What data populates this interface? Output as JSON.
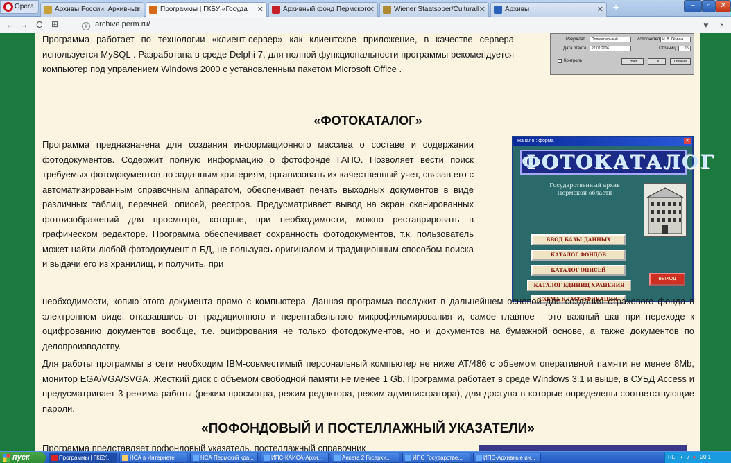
{
  "browser": {
    "menu_label": "Opera",
    "tabs": [
      {
        "label": "Архивы России. Архивные"
      },
      {
        "label": "Программы | ГКБУ «Госуда"
      },
      {
        "label": "Архивный фонд Пермского"
      },
      {
        "label": "Wiener Staatsoper/Culturall"
      },
      {
        "label": "Архивы"
      }
    ],
    "url": "archive.perm.ru/"
  },
  "page": {
    "intro_paragraph": "Программа работает по технологии «клиент-сервер» как клиентское приложение, в качестве сервера используется MySQL . Разработана в среде Delphi 7, для полной функциональности программы рекомендуется компьютер под упралением Windows 2000 с установленным пакетом Microsoft Office .",
    "section1_title": "«ФОТОКАТАЛОГ»",
    "section1_para1": "Программа предназначена для создания информационного массива о составе и содержании фотодокументов. Содержит полную информацию о фотофонде ГАПО. Позволяет вести поиск требуемых фотодокументов по заданным критериям, организовать их качественный учет, связав его с автоматизированным справочным аппаратом, обеспечивает печать выходных документов в виде различных таблиц, перечней, описей, реестров. Предусматривает вывод на экран сканированных фотоизображений для просмотра, которые, при необходимости, можно реставрировать в графическом редакторе. Программа обеспечивает сохранность фотодокументов, т.к. пользователь может найти любой фотодокумент в БД, не пользуясь оригиналом и традиционным способом поиска и выдачи его из хранилищ, и получить, при",
    "section1_para1_cont": "необходимости, копию этого документа прямо с компьютера. Данная программа послужит в дальнейшем основой для создания страхового фонда в электронном виде, отказавшись от традиционного и нерентабельного микрофильмирования и, самое главное - это важный шаг при переходе к оцифрованию документов вообще, т.е. оцифрования не только фотодокументов, но и документов на бумажной основе, а также документов по делопроизводству.",
    "section1_para2": "Для работы программы в сети необходим IBM-совместимый персональный компьютер не ниже AT/486 с объемом оперативной памяти не менее 8Mb, монитор EGA/VGA/SVGA. Жесткий диск с объемом свободной памяти не менее 1 Gb. Программа работает в среде Windows 3.1 и выше, в СУБД Access и предусматривает 3 режима работы (режим просмотра, режим редактора, режим администратора), для доступа в которые определены соответствующие пароли.",
    "section2_title": "«ПОФОНДОВЫЙ И ПОСТЕЛЛАЖНЫЙ УКАЗАТЕЛИ»",
    "section2_partial": "Программа представляет пофондовый указатель, постеллажный справочник"
  },
  "dialog_snippet": {
    "result_label": "Результат",
    "result_value": "Положительный",
    "executor_label": "Исполнитель",
    "executor_value": "И. В. Дёмина",
    "date_label": "Дата ответа",
    "date_value": "22.02.2006",
    "pages_label": "Страниц",
    "pages_value": "15",
    "control_label": "Контроль",
    "btn_report": "Отчет",
    "btn_ok": "Ок",
    "btn_cancel": "Отмена"
  },
  "photocatalog_window": {
    "title": "Начало : форма",
    "brand": "ФОТОКАТАЛОГ",
    "subtitle_line1": "Государственный архив",
    "subtitle_line2": "Пермской области",
    "buttons": [
      {
        "label": "ВВОД БАЗЫ ДАННЫХ"
      },
      {
        "label": "КАТАЛОГ ФОНДОВ"
      },
      {
        "label": "КАТАЛОГ ОПИСЕЙ"
      },
      {
        "label": "КАТАЛОГ ЕДИНИЦ ХРАНЕНИЯ"
      },
      {
        "label": "СХЕМА КЛАССИФИКАЦИИ"
      }
    ],
    "exit_label": "ВЫХОД"
  },
  "taskbar": {
    "start_label": "пуск",
    "tasks": [
      {
        "label": "Программы | ГКБУ..."
      },
      {
        "label": "НСА в Интернете"
      },
      {
        "label": "НСА Пермский кра..."
      },
      {
        "label": "ИПС-КАИСА-Архи..."
      },
      {
        "label": "Анкета 2 Госархи..."
      },
      {
        "label": "ИПС Государстве..."
      },
      {
        "label": "ИПС-Архивные ин..."
      }
    ],
    "tray_lang": "RL",
    "tray_time": "20:1"
  },
  "colors": {
    "page_background": "#1d7a3f",
    "content_background": "#fbf4e1",
    "photocatalog_teal": "#2a6a6a",
    "exit_red": "#cf2f22"
  }
}
